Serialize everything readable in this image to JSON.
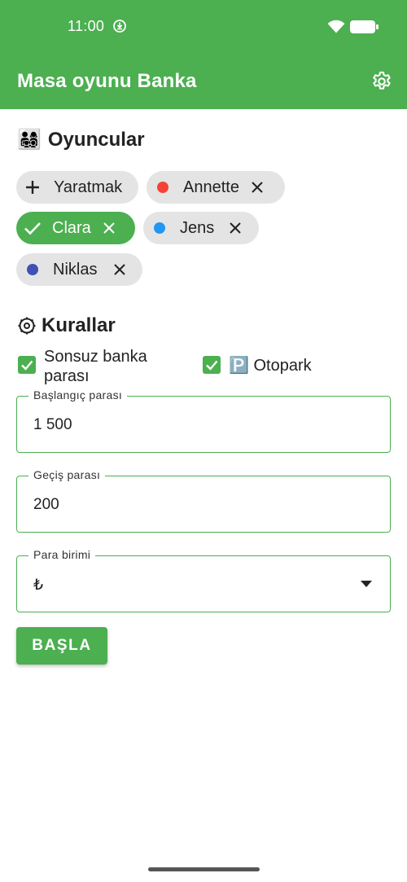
{
  "status_bar": {
    "time": "11:00"
  },
  "app_bar": {
    "title": "Masa oyunu Banka"
  },
  "players_section": {
    "emoji": "👨‍👩‍👧‍👦",
    "title": "Oyuncular",
    "create_label": "Yaratmak",
    "players": [
      {
        "name": "Annette",
        "color": "#f44336",
        "selected": false
      },
      {
        "name": "Clara",
        "color": "#4caf50",
        "selected": true
      },
      {
        "name": "Jens",
        "color": "#2196f3",
        "selected": false
      },
      {
        "name": "Niklas",
        "color": "#3f51b5",
        "selected": false
      }
    ]
  },
  "rules_section": {
    "title": "Kurallar",
    "checkboxes": [
      {
        "label": "Sonsuz banka parası",
        "checked": true
      },
      {
        "label": "🅿️ Otopark",
        "checked": true
      }
    ],
    "fields": {
      "starting_money": {
        "label": "Başlangıç parası",
        "value": "1 500"
      },
      "passing_money": {
        "label": "Geçiş parası",
        "value": "200"
      },
      "currency": {
        "label": "Para birimi",
        "value": "₺"
      }
    }
  },
  "start_button": {
    "label": "BAŞLA"
  },
  "colors": {
    "primary": "#4caf50",
    "chip_bg": "#e4e4e4"
  }
}
